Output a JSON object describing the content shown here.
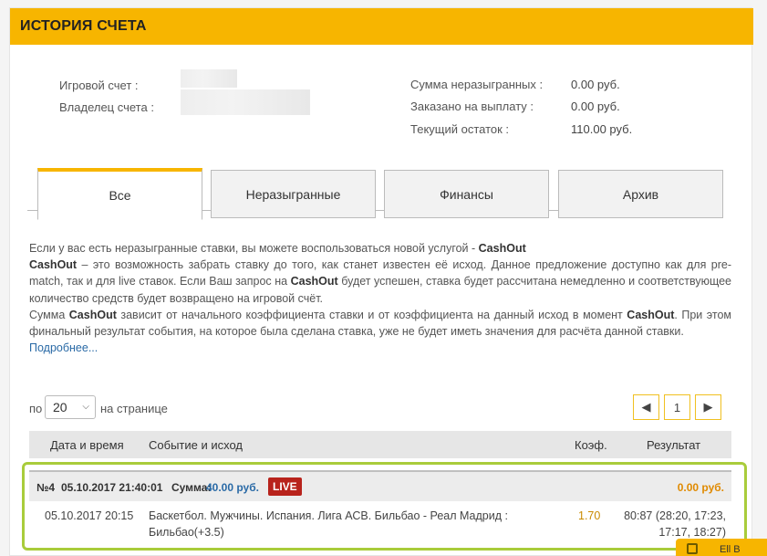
{
  "header": {
    "title": "ИСТОРИЯ СЧЕТА"
  },
  "account": {
    "game_account_label": "Игровой счет :",
    "owner_label": "Владелец счета :",
    "unplayed_label": "Сумма неразыгранных :",
    "unplayed_value": "0.00 руб.",
    "ordered_label": "Заказано на выплату :",
    "ordered_value": "0.00 руб.",
    "balance_label": "Текущий остаток :",
    "balance_value": "110.00 руб."
  },
  "tabs": [
    {
      "label": "Все"
    },
    {
      "label": "Неразыгранные"
    },
    {
      "label": "Финансы"
    },
    {
      "label": "Архив"
    }
  ],
  "description": {
    "p1": "Если у вас есть неразыгранные ставки, вы можете воспользоваться новой услугой - ",
    "cashout": "CashOut",
    "p2": " – это возможность забрать ставку до того, как станет известен её исход. Данное предложение доступно как для pre-match, так и для live ставок. Если Ваш запрос на ",
    "p3": " будет успешен, ставка будет рассчитана немедленно и соответствующее количество средств будет возвращено на игровой счёт.",
    "p4": "Сумма ",
    "p5": " зависит от начального коэффициента ставки и от коэффициента на данный исход в момент ",
    "p6": ". При этом финальный результат события, на которое была сделана ставка, уже не будет иметь значения для расчёта данной ставки.",
    "more": "Подробнее..."
  },
  "pagination": {
    "per_label_pre": "по",
    "per_value": "20",
    "per_label_post": "на странице",
    "prev": "◀",
    "page": "1",
    "next": "▶"
  },
  "table": {
    "headers": [
      "Дата и время",
      "Событие и исход",
      "Коэф.",
      "Результат"
    ]
  },
  "bet": {
    "number": "№4",
    "datetime": "05.10.2017 21:40:01",
    "sum_label": "Сумма:",
    "sum_value": "40.00 руб.",
    "badge": "LIVE",
    "result": "0.00 руб.",
    "row": {
      "date": "05.10.2017 20:15",
      "event": "Баскетбол. Мужчины. Испания. Лига АСВ. Бильбао - Реал Мадрид :",
      "outcome": "Бильбао(+3.5)",
      "coef": "1.70",
      "score_line1": "80:87 (28:20, 17:23,",
      "score_line2": "17:17, 18:27)"
    }
  },
  "corner_button": {
    "label": "Ell B"
  },
  "colors": {
    "accent": "#f7b500",
    "highlight": "#a9cc3b",
    "live": "#b8231c",
    "link": "#2a6aa6",
    "result": "#e08a00"
  }
}
